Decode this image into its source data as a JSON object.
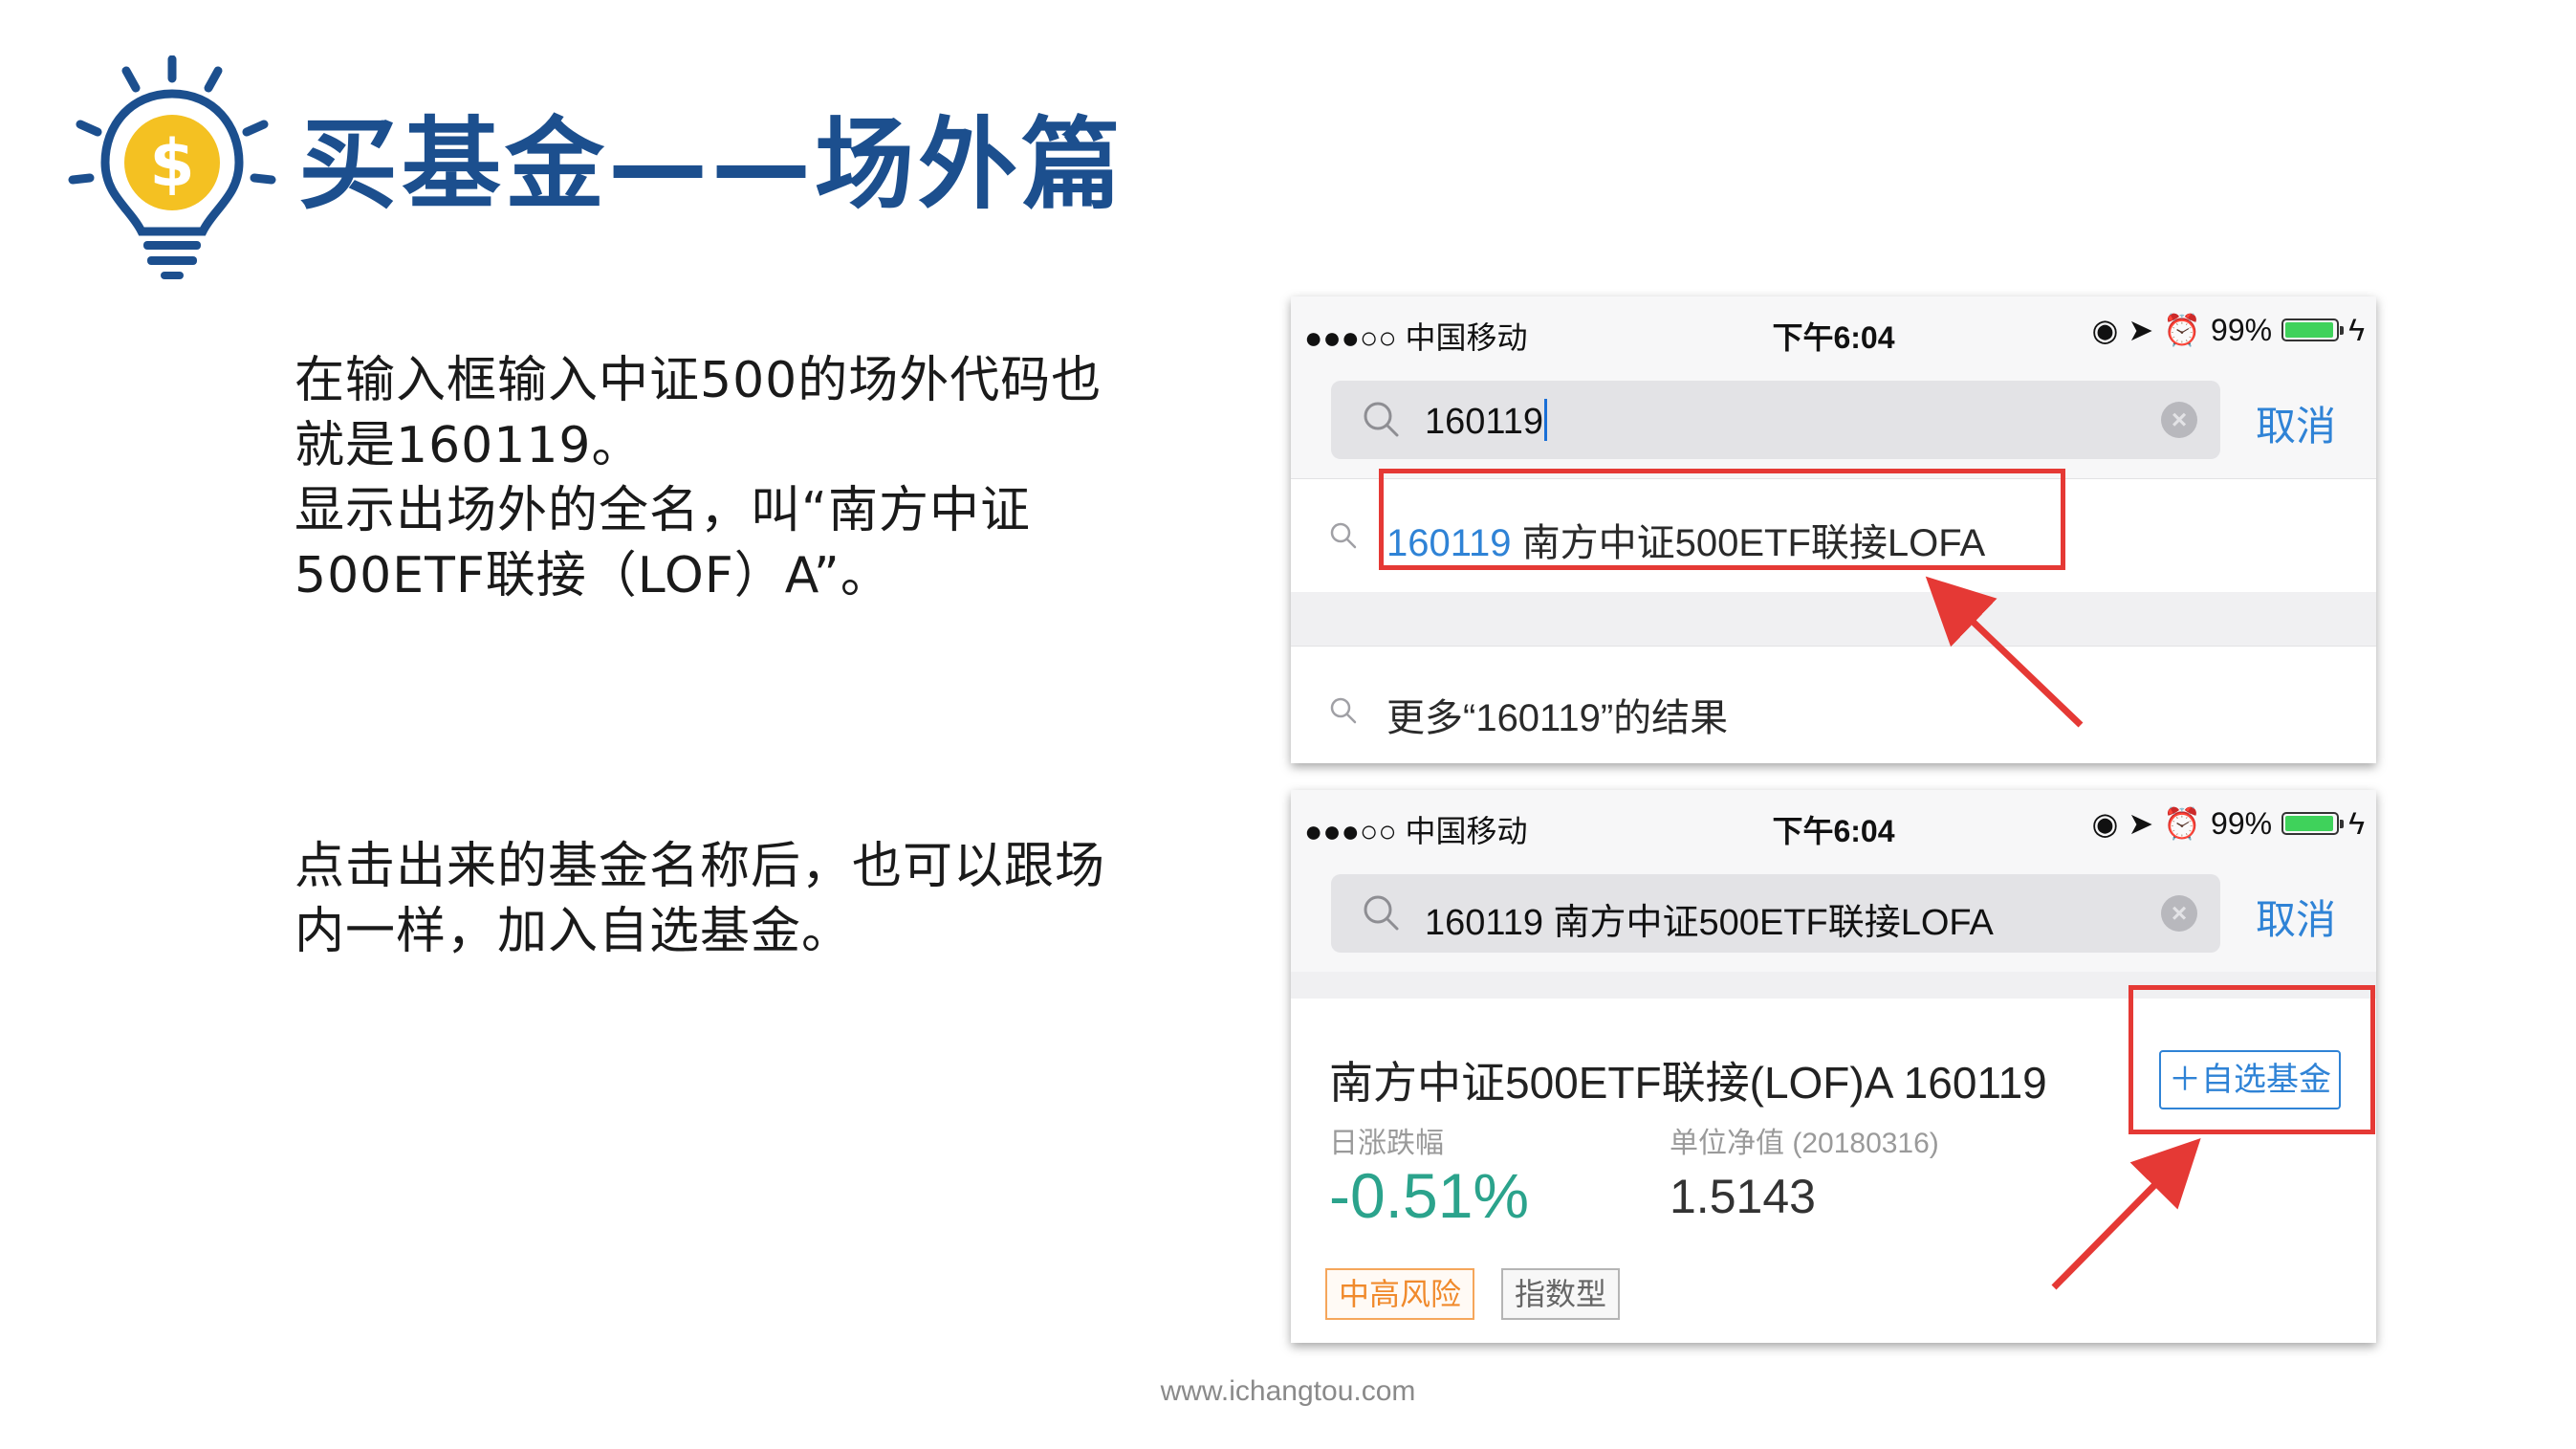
{
  "slide": {
    "title": "买基金——场外篇",
    "para1": [
      "在输入框输入中证500的场外代码也",
      "就是160119。",
      "显示出场外的全名，叫“南方中证",
      "500ETF联接（LOF）A”。"
    ],
    "para2": [
      "点击出来的基金名称后，也可以跟场",
      "内一样，加入自选基金。"
    ],
    "footer": "www.ichangtou.com"
  },
  "colors": {
    "accent_blue": "#1c4f8e",
    "link_blue": "#2f83d6",
    "highlight_red": "#e53935",
    "loss_green": "#2ba38c",
    "risk_orange": "#f08a2c"
  },
  "screen1": {
    "status": {
      "signal": "●●●○○ 中国移动",
      "time": "下午6:04",
      "battery": "99%"
    },
    "search": {
      "value": "160119",
      "cancel": "取消"
    },
    "suggestion": {
      "code": "160119",
      "name": " 南方中证500ETF联接LOFA"
    },
    "more": "更多“160119”的结果"
  },
  "screen2": {
    "status": {
      "signal": "●●●○○ 中国移动",
      "time": "下午6:04",
      "battery": "99%"
    },
    "search": {
      "value": "160119 南方中证500ETF联接LOFA",
      "cancel": "取消"
    },
    "fund": {
      "name": "南方中证500ETF联接(LOF)A 160119",
      "add_button": "＋自选基金",
      "change_label": "日涨跌幅",
      "change_value": "-0.51%",
      "nav_label": "单位净值 (20180316)",
      "nav_value": "1.5143",
      "tags": [
        "中高风险",
        "指数型"
      ]
    }
  }
}
